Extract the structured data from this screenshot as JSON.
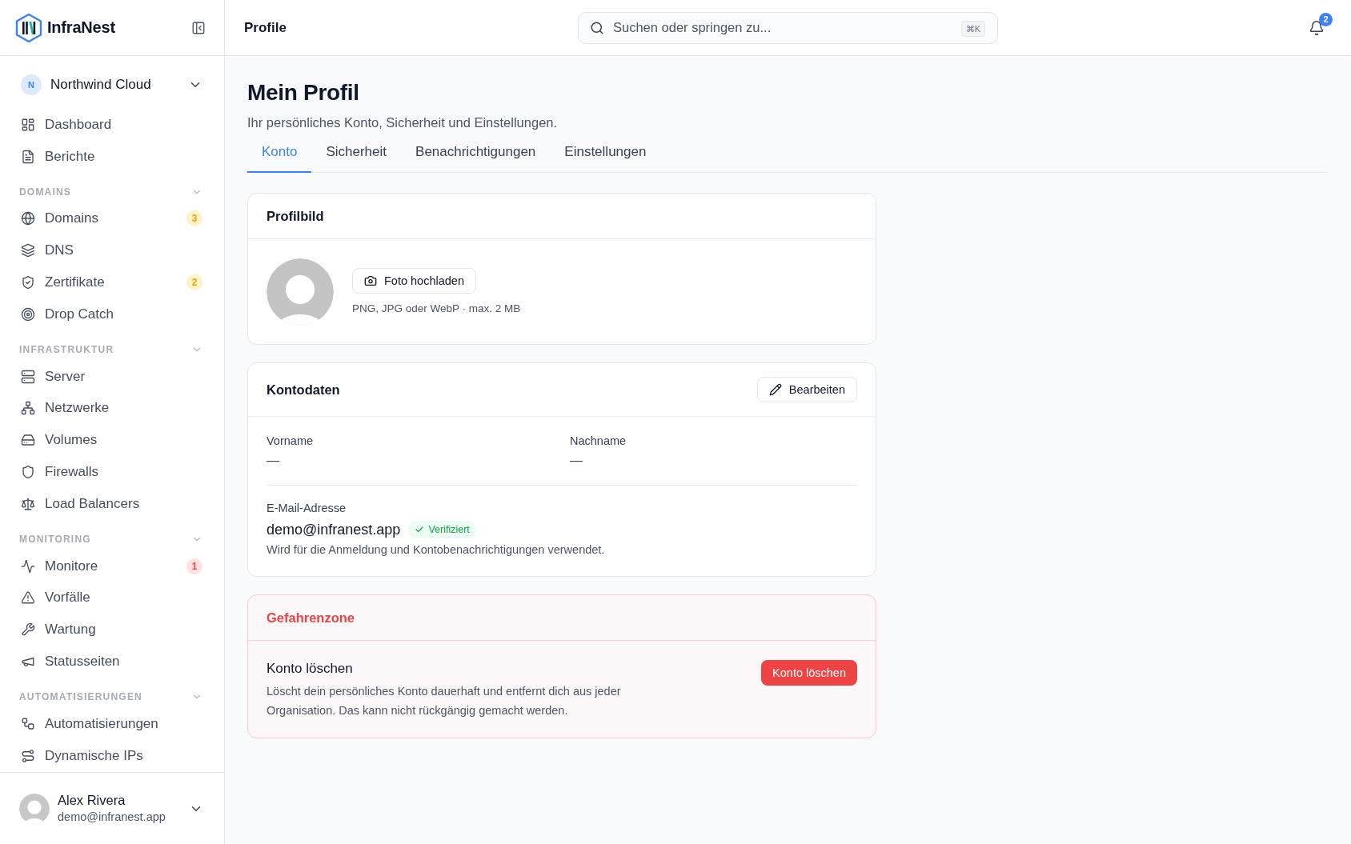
{
  "sidebar": {
    "brand": {
      "name": "InfraNest"
    },
    "workspace": {
      "initial": "N",
      "name": "Northwind Cloud"
    },
    "items": [
      {
        "label": "Dashboard",
        "selected": false
      },
      {
        "label": "Berichte",
        "selected": false
      }
    ],
    "sections": [
      {
        "title": "DOMAINS",
        "expanded": true,
        "items": [
          {
            "label": "Domains",
            "selected": false,
            "badge": {
              "text": "3",
              "kind": "warning"
            }
          },
          {
            "label": "DNS",
            "selected": false
          },
          {
            "label": "Zertifikate",
            "selected": false,
            "badge": {
              "text": "2",
              "kind": "warning"
            }
          },
          {
            "label": "Drop Catch",
            "selected": false
          }
        ]
      },
      {
        "title": "INFRASTRUKTUR",
        "expanded": true,
        "items": [
          {
            "label": "Server",
            "selected": false
          },
          {
            "label": "Netzwerke",
            "selected": false
          },
          {
            "label": "Volumes",
            "selected": false
          },
          {
            "label": "Firewalls",
            "selected": false
          },
          {
            "label": "Load Balancers",
            "selected": false
          }
        ]
      },
      {
        "title": "MONITORING",
        "expanded": true,
        "items": [
          {
            "label": "Monitore",
            "selected": false,
            "badge": {
              "text": "1",
              "kind": "danger"
            }
          },
          {
            "label": "Vorfälle",
            "selected": false
          },
          {
            "label": "Wartung",
            "selected": false
          },
          {
            "label": "Statusseiten",
            "selected": false
          }
        ]
      },
      {
        "title": "AUTOMATISIERUNGEN",
        "expanded": true,
        "items": [
          {
            "label": "Automatisierungen",
            "selected": false
          },
          {
            "label": "Dynamische IPs",
            "selected": false
          }
        ]
      }
    ],
    "user": {
      "name": "Alex Rivera",
      "email": "demo@infranest.app"
    }
  },
  "topbar": {
    "title": "Profile",
    "search": {
      "placeholder": "Suchen oder springen zu...",
      "shortcut": "⌘K"
    },
    "notifications": {
      "count": "2"
    }
  },
  "page": {
    "title": "Mein Profil",
    "subtitle": "Ihr persönliches Konto, Sicherheit und Einstellungen.",
    "tabs": [
      {
        "label": "Konto",
        "selected": true
      },
      {
        "label": "Sicherheit",
        "selected": false
      },
      {
        "label": "Benachrichtigungen",
        "selected": false
      },
      {
        "label": "Einstellungen",
        "selected": false
      }
    ]
  },
  "profile_picture_card": {
    "title": "Profilbild",
    "upload_button": "Foto hochladen",
    "hint": "PNG, JPG oder WebP · max. 2 MB"
  },
  "account_card": {
    "title": "Kontodaten",
    "edit_button": "Bearbeiten",
    "fields": [
      {
        "label": "Vorname",
        "value": "—"
      },
      {
        "label": "Nachname",
        "value": "—"
      }
    ],
    "email": {
      "label": "E-Mail-Adresse",
      "value": "demo@infranest.app",
      "badge": "Verifiziert",
      "note": "Wird für die Anmeldung und Kontobenachrichtigungen verwendet."
    }
  },
  "danger_zone": {
    "title": "Gefahrenzone",
    "action_title": "Konto löschen",
    "description": "Löscht dein persönliches Konto dauerhaft und entfernt dich aus jeder Organisation. Das kann nicht rückgängig gemacht werden.",
    "button": "Konto löschen"
  }
}
